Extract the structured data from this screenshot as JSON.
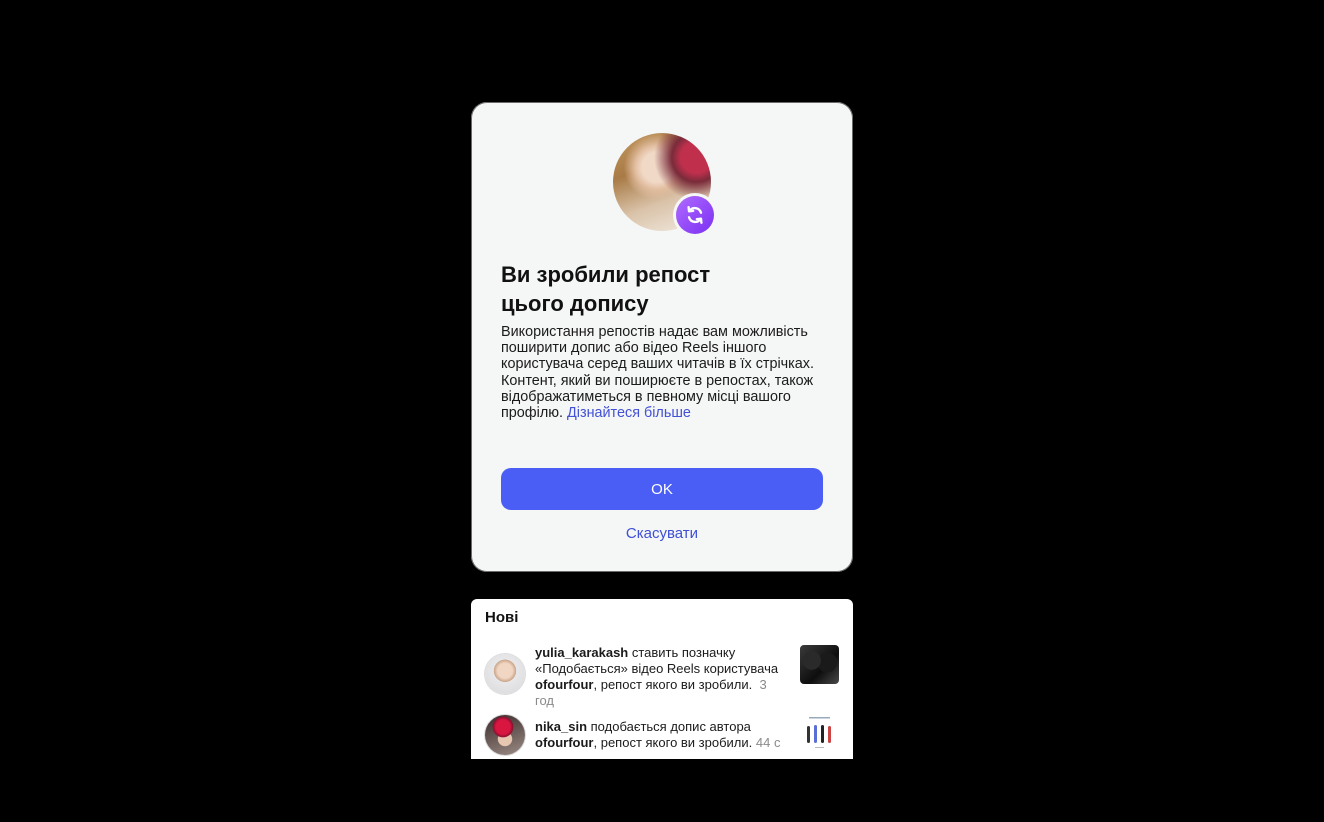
{
  "dialog": {
    "title": "Ви зробили репост\nцього допису",
    "body": "Використання репостів надає вам можливість поширити допис або відео Reels іншого користувача серед ваших читачів в їх стрічках. Контент, який ви поширюєте в репостах, також відображатиметься в певному місці вашого профілю. ",
    "learn_more": "Дізнайтеся більше",
    "ok_label": "OK",
    "cancel_label": "Скасувати",
    "badge_icon": "repost-icon",
    "accent_color": "#4a5ef5"
  },
  "notifications": {
    "section_title": "Нові",
    "items": [
      {
        "user": "yulia_karakash",
        "text_before": " ставить позначку «Подобається» відео Reels користувача ",
        "target_user": "ofourfour",
        "text_after": ", репост якого ви зробили.",
        "time": "3 год"
      },
      {
        "user": "nika_sin",
        "text_before": " подобається допис автора ",
        "target_user": "ofourfour",
        "text_after": ", репост якого ви зробили.",
        "time": "44 с"
      }
    ]
  }
}
